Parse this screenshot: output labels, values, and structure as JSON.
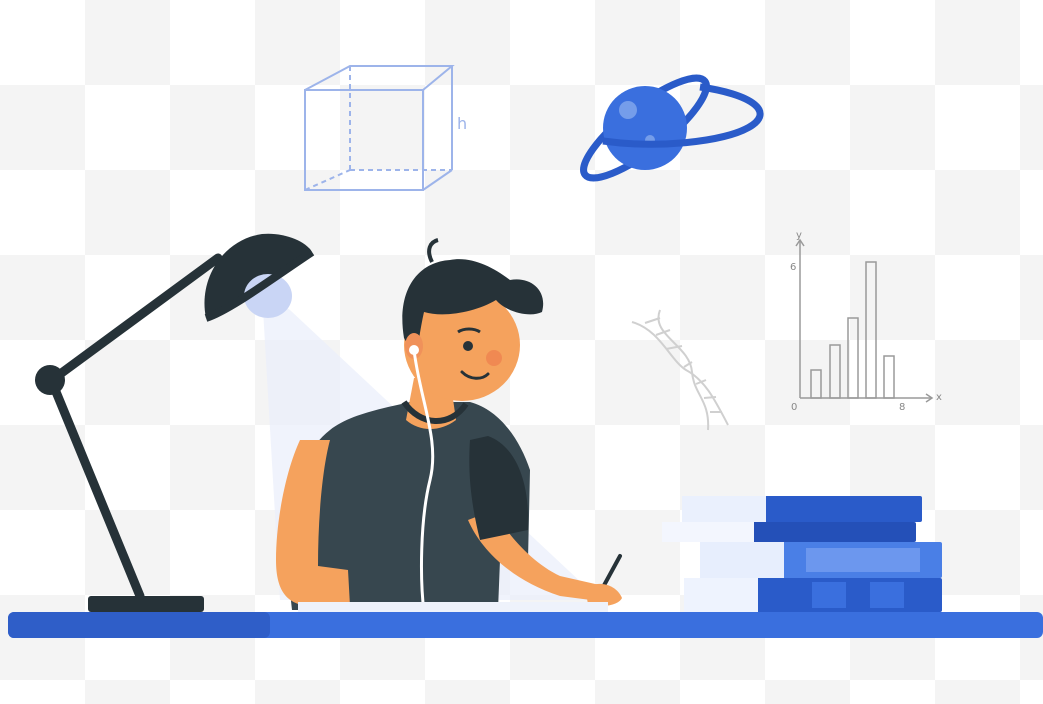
{
  "illustration": {
    "subject": "student-studying-at-desk",
    "accent": "#3a6fde",
    "dark": "#263238",
    "skin": "#f5a25d"
  },
  "cube": {
    "label": "h"
  },
  "mini_chart": {
    "y_label": "y",
    "x_label": "x",
    "origin_label": "0",
    "x_tick_label": "8",
    "y_tick_label": "6"
  },
  "icons": [
    "cube-icon",
    "planet-icon",
    "dna-icon",
    "bar-chart-icon",
    "desk-lamp-icon",
    "books-icon"
  ]
}
